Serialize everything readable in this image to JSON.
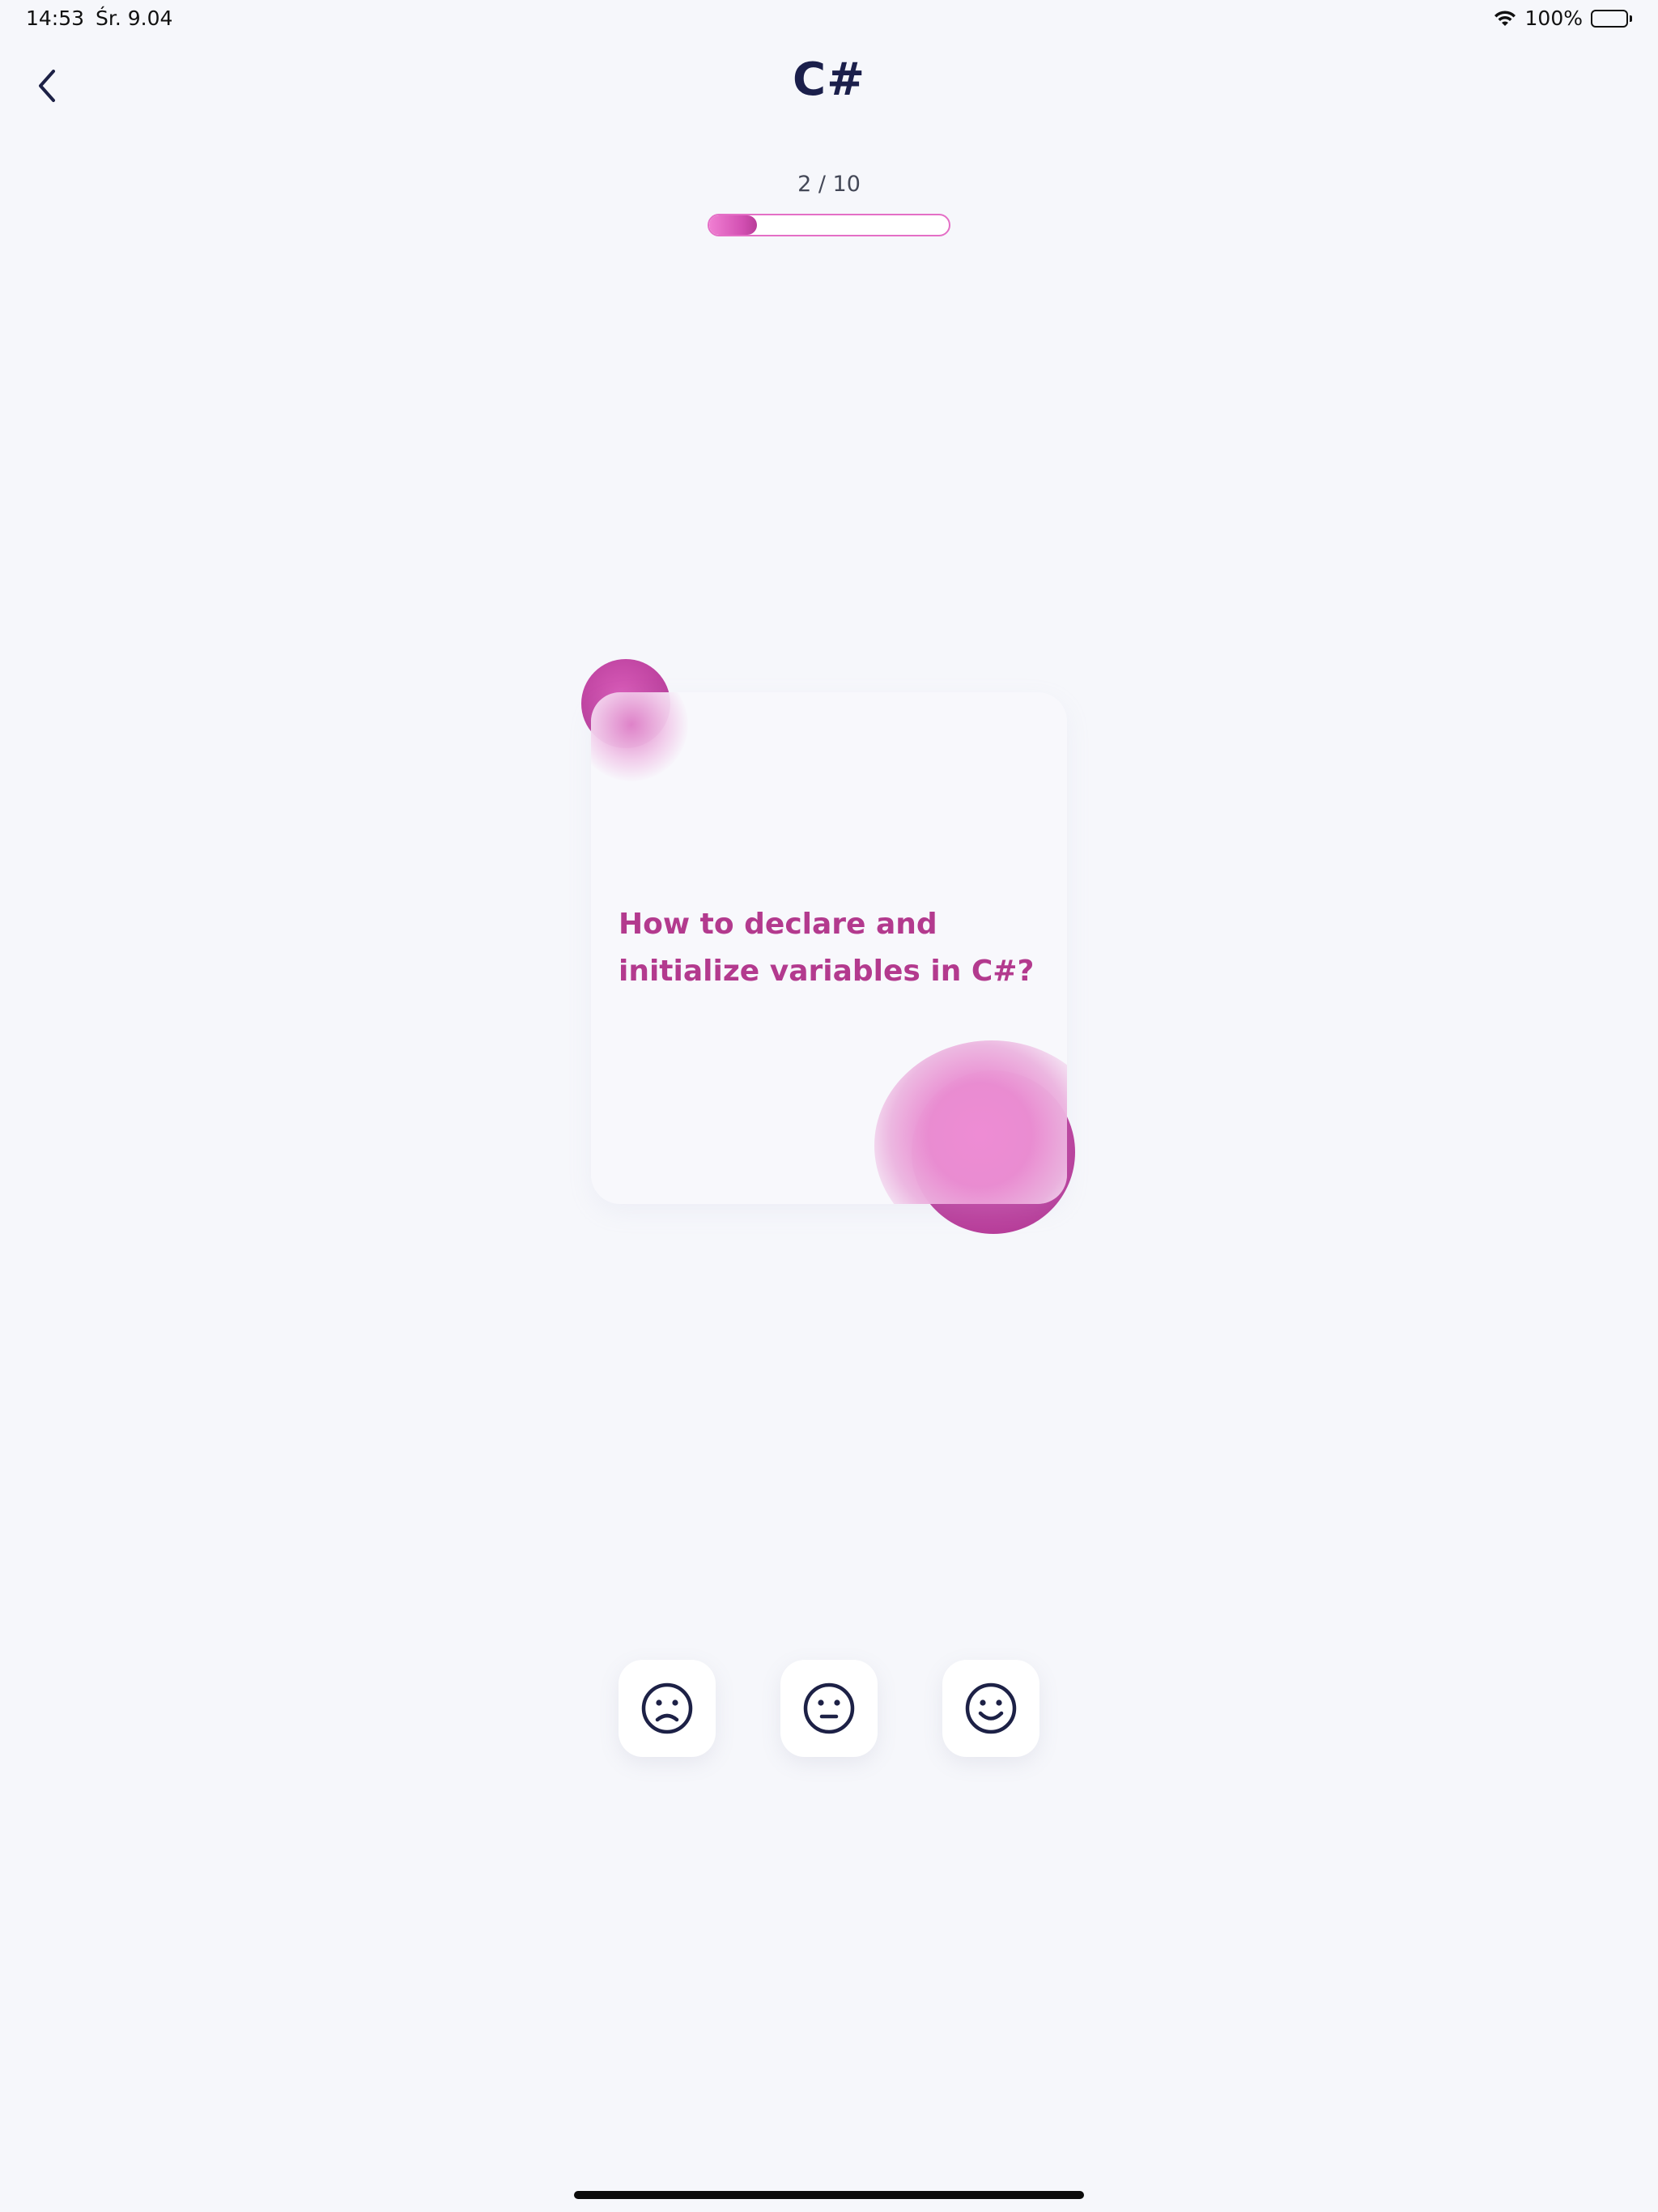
{
  "status_bar": {
    "time": "14:53",
    "date": "Śr. 9.04",
    "battery": "100%",
    "icons": [
      "wifi-icon",
      "battery-icon"
    ]
  },
  "header": {
    "title": "C#",
    "back_icon": "chevron-left-icon"
  },
  "progress": {
    "label": "2 / 10",
    "current": 2,
    "total": 10,
    "fill_fraction": 0.2
  },
  "card": {
    "question": "How to declare and initialize variables in C#?"
  },
  "ratings": [
    {
      "icon": "sad-face-icon"
    },
    {
      "icon": "neutral-face-icon"
    },
    {
      "icon": "happy-face-icon"
    }
  ],
  "colors": {
    "accent": "#c44aa6",
    "question_text": "#b33a8e",
    "title_text": "#1b1f4b",
    "background": "#f6f7fb"
  }
}
